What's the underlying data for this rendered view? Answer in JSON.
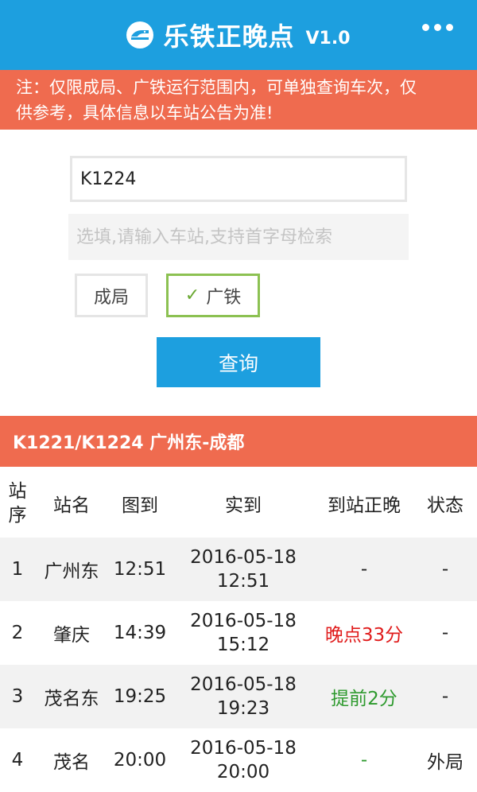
{
  "header": {
    "title": "乐铁正晚点",
    "version": "V1.0",
    "logo_icon": "train-logo-icon",
    "menu_icon": "more-dots-icon"
  },
  "notice": {
    "line1": "注：仅限成局、广铁运行范围内，可单独查询车次，仅",
    "line2": "供参考，具体信息以车站公告为准!"
  },
  "form": {
    "train_value": "K1224",
    "station_placeholder": "选填,请输入车站,支持首字母检索",
    "option_cheng": "成局",
    "option_guang": "广铁",
    "option_guang_checked": true,
    "query_label": "查询"
  },
  "result": {
    "title": "K1221/K1224 广州东-成都",
    "columns": {
      "seq_line1": "站",
      "seq_line2": "序",
      "name": "站名",
      "scheduled": "图到",
      "actual": "实到",
      "delay": "到站正晚",
      "status": "状态"
    },
    "rows": [
      {
        "seq": "1",
        "name": "广州东",
        "scheduled": "12:51",
        "actual_date": "2016-05-18",
        "actual_time": "12:51",
        "delay": "-",
        "status": "-"
      },
      {
        "seq": "2",
        "name": "肇庆",
        "scheduled": "14:39",
        "actual_date": "2016-05-18",
        "actual_time": "15:12",
        "delay": "晚点33分",
        "status": "-"
      },
      {
        "seq": "3",
        "name": "茂名东",
        "scheduled": "19:25",
        "actual_date": "2016-05-18",
        "actual_time": "19:23",
        "delay": "提前2分",
        "status": "-"
      },
      {
        "seq": "4",
        "name": "茂名",
        "scheduled": "20:00",
        "actual_date": "2016-05-18",
        "actual_time": "20:00",
        "delay": "-",
        "status": "外局"
      }
    ]
  },
  "colors": {
    "primary": "#1d9fdf",
    "accent": "#ef6b4f",
    "late": "#e01b1b",
    "early": "#2e9a2e",
    "checked_border": "#8cc152"
  }
}
